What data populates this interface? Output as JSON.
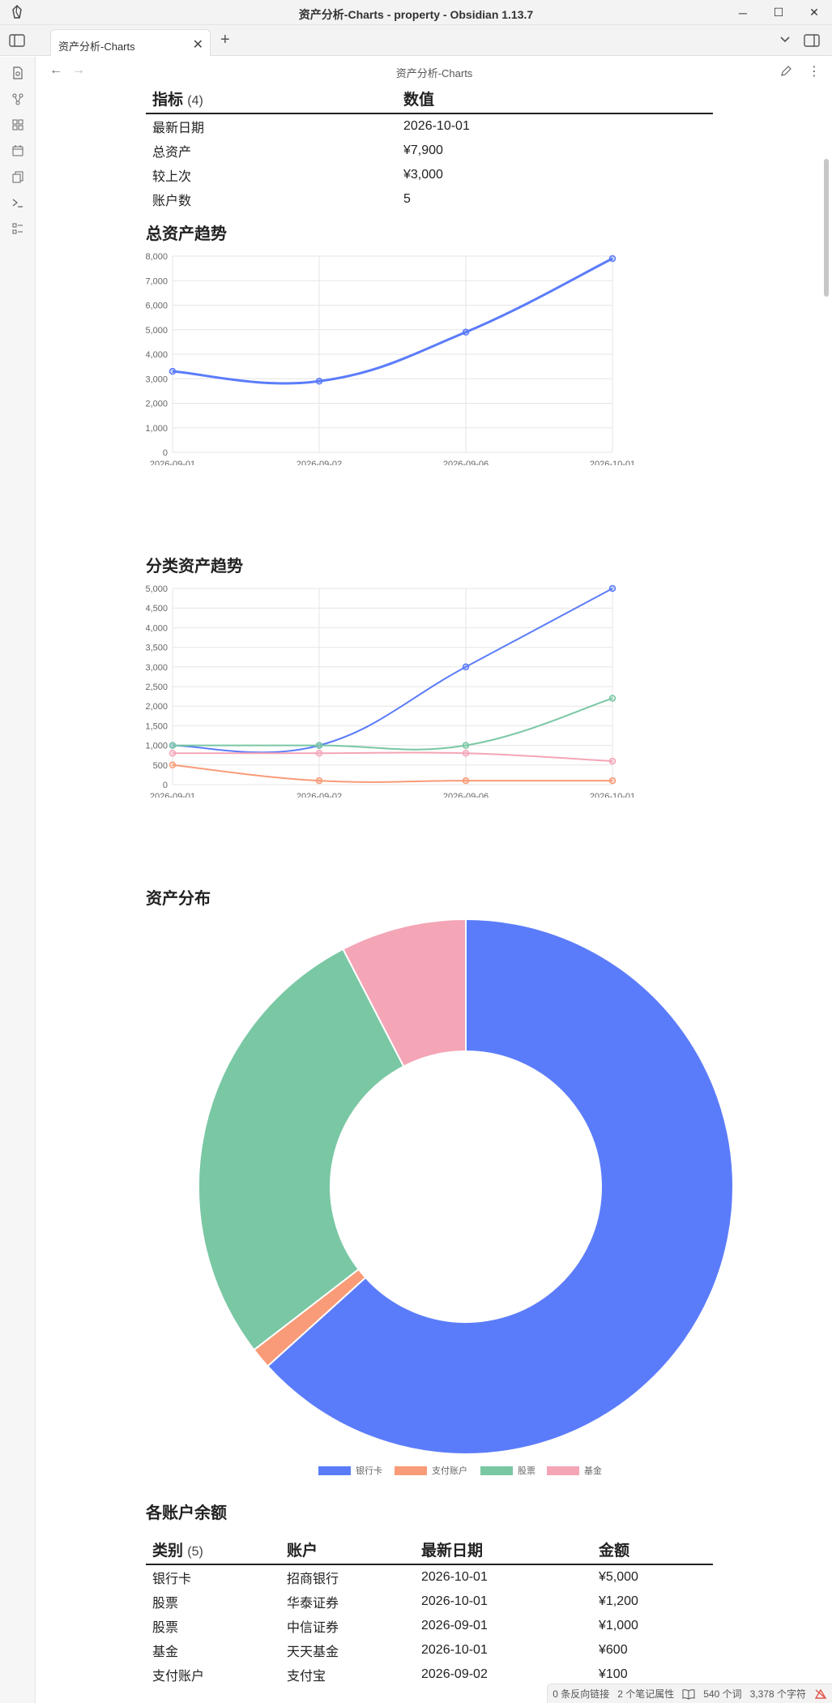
{
  "window": {
    "title": "资产分析-Charts - property - Obsidian 1.13.7"
  },
  "tabs": [
    {
      "label": "资产分析-Charts"
    }
  ],
  "view": {
    "title": "资产分析-Charts"
  },
  "summary_table": {
    "headers": [
      "指标",
      "数值"
    ],
    "count": "(4)",
    "rows": [
      [
        "最新日期",
        "2026-10-01"
      ],
      [
        "总资产",
        "¥7,900"
      ],
      [
        "较上次",
        "¥3,000"
      ],
      [
        "账户数",
        "5"
      ]
    ]
  },
  "sections": {
    "total_trend": "总资产趋势",
    "category_trend": "分类资产趋势",
    "distribution": "资产分布",
    "balances": "各账户余额"
  },
  "colors": {
    "blue": "#5b7cfa",
    "orange": "#f99b78",
    "green": "#7ac7a4",
    "pink": "#f4a5b6"
  },
  "chart_data": [
    {
      "type": "line",
      "x": [
        "2026-09-01",
        "2026-09-02",
        "2026-09-06",
        "2026-10-01"
      ],
      "ylim": [
        0,
        8000
      ],
      "yticks": [
        "0",
        "1,000",
        "2,000",
        "3,000",
        "4,000",
        "5,000",
        "6,000",
        "7,000",
        "8,000"
      ],
      "series": [
        {
          "name": "总资产",
          "values": [
            3300,
            2900,
            4900,
            7900
          ]
        }
      ],
      "legend": "bottom",
      "grid": true
    },
    {
      "type": "line",
      "x": [
        "2026-09-01",
        "2026-09-02",
        "2026-09-06",
        "2026-10-01"
      ],
      "ylim": [
        0,
        5000
      ],
      "yticks": [
        "0",
        "500",
        "1,000",
        "1,500",
        "2,000",
        "2,500",
        "3,000",
        "3,500",
        "4,000",
        "4,500",
        "5,000"
      ],
      "series": [
        {
          "name": "银行卡",
          "values": [
            1000,
            1000,
            3000,
            5000
          ]
        },
        {
          "name": "支付账户",
          "values": [
            500,
            100,
            100,
            100
          ]
        },
        {
          "name": "股票",
          "values": [
            1000,
            1000,
            1000,
            2200
          ]
        },
        {
          "name": "基金",
          "values": [
            800,
            800,
            800,
            600
          ]
        }
      ],
      "legend": "bottom",
      "grid": true
    },
    {
      "type": "pie",
      "variant": "doughnut",
      "categories": [
        "银行卡",
        "支付账户",
        "股票",
        "基金"
      ],
      "values": [
        5000,
        100,
        2200,
        600
      ],
      "legend": "bottom"
    }
  ],
  "balances_table": {
    "headers": [
      "类别",
      "账户",
      "最新日期",
      "金额"
    ],
    "count": "(5)",
    "rows": [
      [
        "银行卡",
        "招商银行",
        "2026-10-01",
        "¥5,000"
      ],
      [
        "股票",
        "华泰证券",
        "2026-10-01",
        "¥1,200"
      ],
      [
        "股票",
        "中信证券",
        "2026-09-01",
        "¥1,000"
      ],
      [
        "基金",
        "天天基金",
        "2026-10-01",
        "¥600"
      ],
      [
        "支付账户",
        "支付宝",
        "2026-09-02",
        "¥100"
      ]
    ]
  },
  "status": {
    "backlinks": "0 条反向链接",
    "properties": "2 个笔记属性",
    "words": "540 个词",
    "chars": "3,378 个字符"
  }
}
